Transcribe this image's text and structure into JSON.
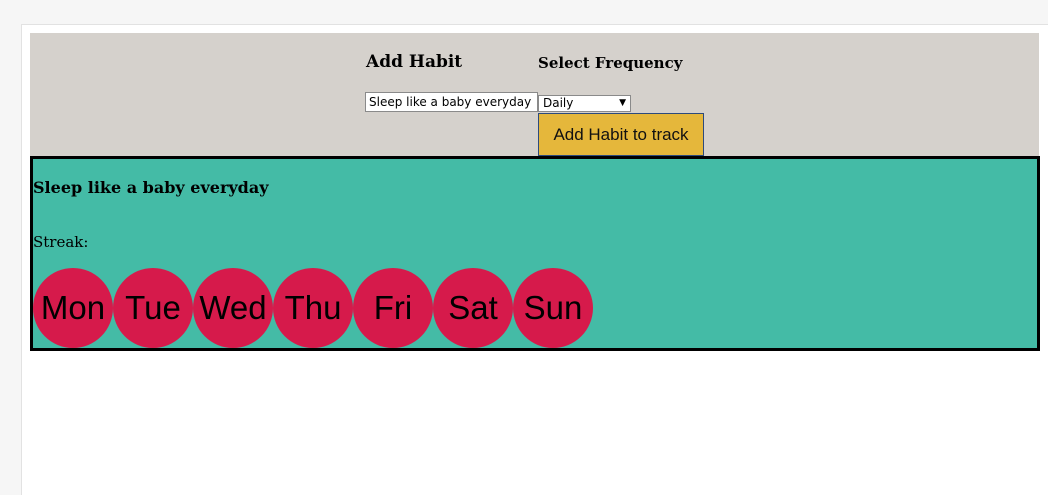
{
  "form": {
    "add_habit_title": "Add Habit",
    "frequency_title": "Select Frequency",
    "habit_input_value": "Sleep like a baby everyday",
    "frequency_selected": "Daily",
    "submit_label": "Add Habit to track"
  },
  "habit": {
    "name": "Sleep like a baby everyday",
    "streak_label": "Streak:",
    "days": [
      "Mon",
      "Tue",
      "Wed",
      "Thu",
      "Fri",
      "Sat",
      "Sun"
    ]
  },
  "colors": {
    "header_bg": "#d5d1cc",
    "card_bg": "#44bba6",
    "day_circle": "#d61a4b",
    "button_bg": "#e5b73b"
  }
}
